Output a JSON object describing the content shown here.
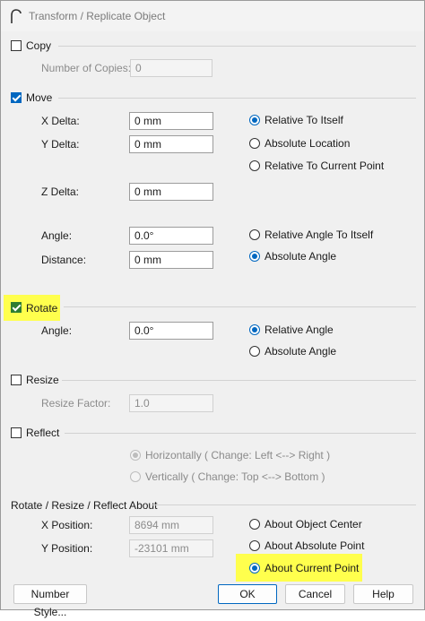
{
  "window": {
    "title": "Transform / Replicate Object"
  },
  "copy": {
    "label": "Copy",
    "checked": false,
    "num_copies_label": "Number of Copies:",
    "num_copies_value": "0"
  },
  "move": {
    "label": "Move",
    "checked": true,
    "x_delta_label": "X Delta:",
    "x_delta_value": "0 mm",
    "y_delta_label": "Y Delta:",
    "y_delta_value": "0 mm",
    "z_delta_label": "Z Delta:",
    "z_delta_value": "0 mm",
    "angle_label": "Angle:",
    "angle_value": "0.0°",
    "distance_label": "Distance:",
    "distance_value": "0 mm",
    "ref_options": [
      "Relative To Itself",
      "Absolute Location",
      "Relative To Current Point"
    ],
    "ref_selected": 0,
    "angle_options": [
      "Relative Angle To Itself",
      "Absolute Angle"
    ],
    "angle_selected": 1
  },
  "rotate": {
    "label": "Rotate",
    "checked": true,
    "angle_label": "Angle:",
    "angle_value": "0.0°",
    "options": [
      "Relative Angle",
      "Absolute Angle"
    ],
    "selected": 0
  },
  "resize": {
    "label": "Resize",
    "checked": false,
    "factor_label": "Resize Factor:",
    "factor_value": "1.0"
  },
  "reflect": {
    "label": "Reflect",
    "checked": false,
    "options": [
      "Horizontally ( Change: Left <--> Right )",
      "Vertically ( Change: Top <--> Bottom )"
    ],
    "selected": 0
  },
  "about": {
    "group_label": "Rotate / Resize / Reflect About",
    "x_label": "X Position:",
    "x_value": "8694 mm",
    "y_label": "Y Position:",
    "y_value": "-23101 mm",
    "options": [
      "About Object Center",
      "About Absolute Point",
      "About Current Point"
    ],
    "selected": 2
  },
  "buttons": {
    "number_style": "Number Style...",
    "ok": "OK",
    "cancel": "Cancel",
    "help": "Help"
  },
  "colors": {
    "highlight": "#ffff4d",
    "accent": "#0067c0"
  }
}
